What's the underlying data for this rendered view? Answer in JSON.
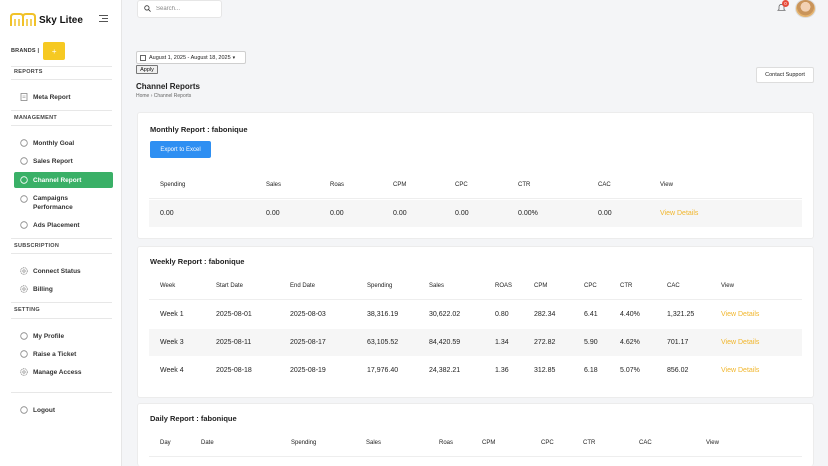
{
  "app": {
    "name": "Sky Litee"
  },
  "sidebar": {
    "brands_label": "BRANDS |",
    "brand_button": "+",
    "sections": [
      {
        "label": "REPORTS",
        "items": [
          {
            "label": "Meta Report",
            "icon": "document-icon"
          }
        ]
      },
      {
        "label": "MANAGEMENT",
        "items": [
          {
            "label": "Monthly Goal",
            "icon": "chat-icon"
          },
          {
            "label": "Sales Report",
            "icon": "chat-icon"
          },
          {
            "label": "Channel Report",
            "icon": "chat-icon",
            "active": true
          },
          {
            "label": "Campaigns Performance",
            "icon": "chat-icon"
          },
          {
            "label": "Ads Placement",
            "icon": "chat-icon"
          }
        ]
      },
      {
        "label": "SUBSCRIPTION",
        "items": [
          {
            "label": "Connect Status",
            "icon": "gear-icon"
          },
          {
            "label": "Billing",
            "icon": "gear-icon"
          }
        ]
      },
      {
        "label": "SETTING",
        "items": [
          {
            "label": "My Profile",
            "icon": "chat-icon"
          },
          {
            "label": "Raise a Ticket",
            "icon": "chat-icon"
          },
          {
            "label": "Manage Access",
            "icon": "gear-icon"
          }
        ]
      }
    ],
    "logout": "Logout"
  },
  "topbar": {
    "search_placeholder": "Search...",
    "notification_count": "0"
  },
  "toolbar": {
    "date_range": "August 1, 2025 - August 18, 2025",
    "apply": "Apply",
    "contact_support": "Contact Support"
  },
  "page": {
    "title": "Channel Reports",
    "breadcrumb": "Home  ›  Channel Reports"
  },
  "monthly": {
    "title": "Monthly Report : fabonique",
    "export": "Export to Excel",
    "columns": [
      "Spending",
      "Sales",
      "Roas",
      "CPM",
      "CPC",
      "CTR",
      "CAC",
      "View"
    ],
    "row": [
      "0.00",
      "0.00",
      "0.00",
      "0.00",
      "0.00",
      "0.00%",
      "0.00",
      "View Details"
    ]
  },
  "weekly": {
    "title": "Weekly Report : fabonique",
    "columns": [
      "Week",
      "Start Date",
      "End Date",
      "Spending",
      "Sales",
      "ROAS",
      "CPM",
      "CPC",
      "CTR",
      "CAC",
      "View"
    ],
    "rows": [
      [
        "Week 1",
        "2025-08-01",
        "2025-08-03",
        "38,316.19",
        "30,622.02",
        "0.80",
        "282.34",
        "6.41",
        "4.40%",
        "1,321.25",
        "View Details"
      ],
      [
        "Week 3",
        "2025-08-11",
        "2025-08-17",
        "63,105.52",
        "84,420.59",
        "1.34",
        "272.82",
        "5.90",
        "4.62%",
        "701.17",
        "View Details"
      ],
      [
        "Week 4",
        "2025-08-18",
        "2025-08-19",
        "17,976.40",
        "24,382.21",
        "1.36",
        "312.85",
        "6.18",
        "5.07%",
        "856.02",
        "View Details"
      ]
    ]
  },
  "daily": {
    "title": "Daily Report : fabonique",
    "columns": [
      "Day",
      "Date",
      "Spending",
      "Sales",
      "Roas",
      "CPM",
      "CPC",
      "CTR",
      "CAC",
      "View"
    ]
  },
  "colors": {
    "accent": "#3ab067",
    "brand": "#f6c922",
    "primary": "#2e8ff2",
    "link": "#f1b62c"
  }
}
